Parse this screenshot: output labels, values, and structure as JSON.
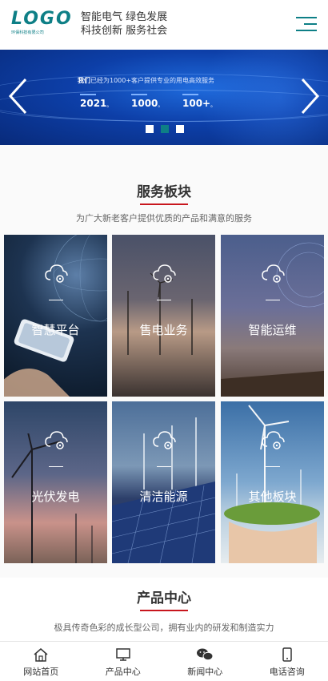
{
  "header": {
    "logo_text": "LOGO",
    "logo_sub": "环保科技有限公司",
    "slogan_line1": "智能电气 绿色发展",
    "slogan_line2": "科技创新 服务社会",
    "menu_icon": "hamburger-icon"
  },
  "banner": {
    "line_bold": "我们",
    "line_rest": "已经为1000+客户提供专业的用电高效服务",
    "stats": [
      "2021",
      "1000",
      "100+"
    ],
    "slides": 3,
    "active_slide": 2
  },
  "services": {
    "title": "服务板块",
    "subtitle": "为广大新老客户提供优质的产品和满意的服务",
    "items": [
      {
        "label": "智慧平台",
        "icon": "cloud-gear-icon"
      },
      {
        "label": "售电业务",
        "icon": "cloud-gear-icon"
      },
      {
        "label": "智能运维",
        "icon": "cloud-gear-icon"
      },
      {
        "label": "光伏发电",
        "icon": "cloud-gear-icon"
      },
      {
        "label": "清洁能源",
        "icon": "cloud-gear-icon"
      },
      {
        "label": "其他板块",
        "icon": "cloud-gear-icon"
      }
    ]
  },
  "products": {
    "title": "产品中心",
    "subtitle": "极具传奇色彩的成长型公司，拥有业内的研发和制造实力"
  },
  "tabbar": [
    {
      "label": "网站首页",
      "icon": "home-icon"
    },
    {
      "label": "产品中心",
      "icon": "monitor-icon"
    },
    {
      "label": "新闻中心",
      "icon": "wechat-icon"
    },
    {
      "label": "电话咨询",
      "icon": "phone-icon"
    }
  ],
  "colors": {
    "accent": "#0e7f86",
    "underline": "#c8161d",
    "banner": "#0d3fa8"
  }
}
